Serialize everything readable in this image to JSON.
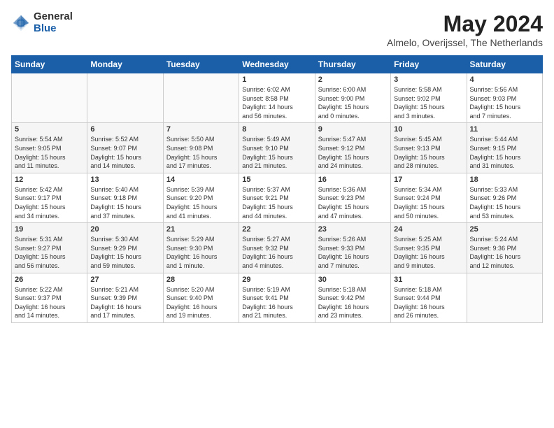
{
  "logo": {
    "general": "General",
    "blue": "Blue"
  },
  "title": "May 2024",
  "subtitle": "Almelo, Overijssel, The Netherlands",
  "days_of_week": [
    "Sunday",
    "Monday",
    "Tuesday",
    "Wednesday",
    "Thursday",
    "Friday",
    "Saturday"
  ],
  "weeks": [
    [
      {
        "day": "",
        "info": ""
      },
      {
        "day": "",
        "info": ""
      },
      {
        "day": "",
        "info": ""
      },
      {
        "day": "1",
        "info": "Sunrise: 6:02 AM\nSunset: 8:58 PM\nDaylight: 14 hours\nand 56 minutes."
      },
      {
        "day": "2",
        "info": "Sunrise: 6:00 AM\nSunset: 9:00 PM\nDaylight: 15 hours\nand 0 minutes."
      },
      {
        "day": "3",
        "info": "Sunrise: 5:58 AM\nSunset: 9:02 PM\nDaylight: 15 hours\nand 3 minutes."
      },
      {
        "day": "4",
        "info": "Sunrise: 5:56 AM\nSunset: 9:03 PM\nDaylight: 15 hours\nand 7 minutes."
      }
    ],
    [
      {
        "day": "5",
        "info": "Sunrise: 5:54 AM\nSunset: 9:05 PM\nDaylight: 15 hours\nand 11 minutes."
      },
      {
        "day": "6",
        "info": "Sunrise: 5:52 AM\nSunset: 9:07 PM\nDaylight: 15 hours\nand 14 minutes."
      },
      {
        "day": "7",
        "info": "Sunrise: 5:50 AM\nSunset: 9:08 PM\nDaylight: 15 hours\nand 17 minutes."
      },
      {
        "day": "8",
        "info": "Sunrise: 5:49 AM\nSunset: 9:10 PM\nDaylight: 15 hours\nand 21 minutes."
      },
      {
        "day": "9",
        "info": "Sunrise: 5:47 AM\nSunset: 9:12 PM\nDaylight: 15 hours\nand 24 minutes."
      },
      {
        "day": "10",
        "info": "Sunrise: 5:45 AM\nSunset: 9:13 PM\nDaylight: 15 hours\nand 28 minutes."
      },
      {
        "day": "11",
        "info": "Sunrise: 5:44 AM\nSunset: 9:15 PM\nDaylight: 15 hours\nand 31 minutes."
      }
    ],
    [
      {
        "day": "12",
        "info": "Sunrise: 5:42 AM\nSunset: 9:17 PM\nDaylight: 15 hours\nand 34 minutes."
      },
      {
        "day": "13",
        "info": "Sunrise: 5:40 AM\nSunset: 9:18 PM\nDaylight: 15 hours\nand 37 minutes."
      },
      {
        "day": "14",
        "info": "Sunrise: 5:39 AM\nSunset: 9:20 PM\nDaylight: 15 hours\nand 41 minutes."
      },
      {
        "day": "15",
        "info": "Sunrise: 5:37 AM\nSunset: 9:21 PM\nDaylight: 15 hours\nand 44 minutes."
      },
      {
        "day": "16",
        "info": "Sunrise: 5:36 AM\nSunset: 9:23 PM\nDaylight: 15 hours\nand 47 minutes."
      },
      {
        "day": "17",
        "info": "Sunrise: 5:34 AM\nSunset: 9:24 PM\nDaylight: 15 hours\nand 50 minutes."
      },
      {
        "day": "18",
        "info": "Sunrise: 5:33 AM\nSunset: 9:26 PM\nDaylight: 15 hours\nand 53 minutes."
      }
    ],
    [
      {
        "day": "19",
        "info": "Sunrise: 5:31 AM\nSunset: 9:27 PM\nDaylight: 15 hours\nand 56 minutes."
      },
      {
        "day": "20",
        "info": "Sunrise: 5:30 AM\nSunset: 9:29 PM\nDaylight: 15 hours\nand 59 minutes."
      },
      {
        "day": "21",
        "info": "Sunrise: 5:29 AM\nSunset: 9:30 PM\nDaylight: 16 hours\nand 1 minute."
      },
      {
        "day": "22",
        "info": "Sunrise: 5:27 AM\nSunset: 9:32 PM\nDaylight: 16 hours\nand 4 minutes."
      },
      {
        "day": "23",
        "info": "Sunrise: 5:26 AM\nSunset: 9:33 PM\nDaylight: 16 hours\nand 7 minutes."
      },
      {
        "day": "24",
        "info": "Sunrise: 5:25 AM\nSunset: 9:35 PM\nDaylight: 16 hours\nand 9 minutes."
      },
      {
        "day": "25",
        "info": "Sunrise: 5:24 AM\nSunset: 9:36 PM\nDaylight: 16 hours\nand 12 minutes."
      }
    ],
    [
      {
        "day": "26",
        "info": "Sunrise: 5:22 AM\nSunset: 9:37 PM\nDaylight: 16 hours\nand 14 minutes."
      },
      {
        "day": "27",
        "info": "Sunrise: 5:21 AM\nSunset: 9:39 PM\nDaylight: 16 hours\nand 17 minutes."
      },
      {
        "day": "28",
        "info": "Sunrise: 5:20 AM\nSunset: 9:40 PM\nDaylight: 16 hours\nand 19 minutes."
      },
      {
        "day": "29",
        "info": "Sunrise: 5:19 AM\nSunset: 9:41 PM\nDaylight: 16 hours\nand 21 minutes."
      },
      {
        "day": "30",
        "info": "Sunrise: 5:18 AM\nSunset: 9:42 PM\nDaylight: 16 hours\nand 23 minutes."
      },
      {
        "day": "31",
        "info": "Sunrise: 5:18 AM\nSunset: 9:44 PM\nDaylight: 16 hours\nand 26 minutes."
      },
      {
        "day": "",
        "info": ""
      }
    ]
  ]
}
